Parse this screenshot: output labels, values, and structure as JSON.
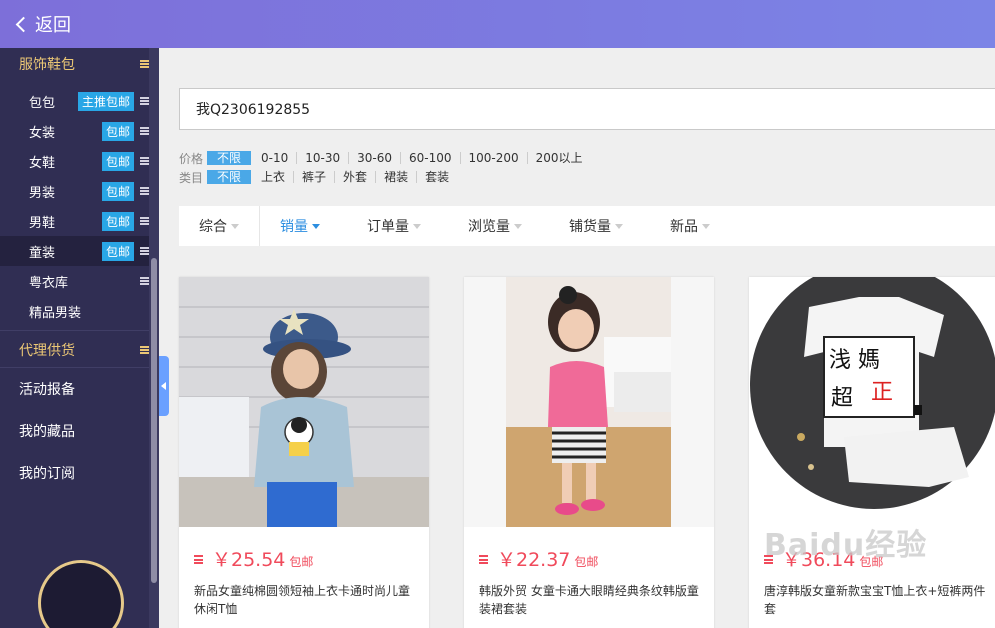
{
  "header": {
    "back_label": "返回"
  },
  "sidebar": {
    "section1": "服饰鞋包",
    "items": [
      {
        "label": "包包",
        "tag": "主推包邮"
      },
      {
        "label": "女装",
        "tag": "包邮"
      },
      {
        "label": "女鞋",
        "tag": "包邮"
      },
      {
        "label": "男装",
        "tag": "包邮"
      },
      {
        "label": "男鞋",
        "tag": "包邮"
      },
      {
        "label": "童装",
        "tag": "包邮"
      },
      {
        "label": "粤衣库",
        "tag": ""
      },
      {
        "label": "精品男装",
        "tag": ""
      }
    ],
    "section2": "代理供货",
    "links": [
      "活动报备",
      "我的藏品",
      "我的订阅"
    ]
  },
  "search": {
    "value": "我Q2306192855"
  },
  "filters": {
    "price": {
      "name": "价格",
      "selected": "不限",
      "options": [
        "0-10",
        "10-30",
        "30-60",
        "60-100",
        "100-200",
        "200以上"
      ]
    },
    "category": {
      "name": "类目",
      "selected": "不限",
      "options": [
        "上衣",
        "裤子",
        "外套",
        "裙装",
        "套装"
      ]
    }
  },
  "sort": [
    "综合",
    "销量",
    "订单量",
    "浏览量",
    "铺货量",
    "新品"
  ],
  "products": [
    {
      "price": "￥25.54",
      "shipping": "包邮",
      "title": "新品女童纯棉圆领短袖上衣卡通时尚儿童休闲T恤"
    },
    {
      "price": "￥22.37",
      "shipping": "包邮",
      "title": "韩版外贸 女童卡通大眼睛经典条纹韩版童装裙套装"
    },
    {
      "price": "￥36.14",
      "shipping": "包邮",
      "title": "唐淳韩版女童新款宝宝T恤上衣+短裤两件套"
    }
  ],
  "watermark": "Baidu经验",
  "colors": {
    "accent": "#2c8ee0",
    "price": "#f04a5b",
    "sidebar": "#302e53",
    "gold": "#ebc775"
  }
}
